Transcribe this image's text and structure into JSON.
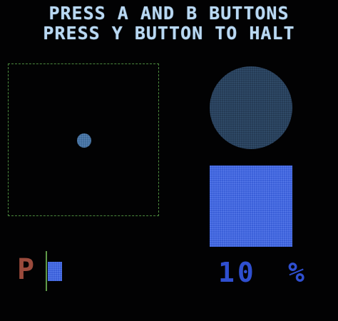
{
  "header": {
    "line1": "PRESS A AND B BUTTONS",
    "line2": "PRESS Y BUTTON TO HALT"
  },
  "gauge": {
    "label": "P",
    "level_fraction": 0.5
  },
  "readout": {
    "value": "10",
    "unit": "%"
  },
  "colors": {
    "title": "#b9d8f2",
    "play_area_border": "#4c8a3e",
    "ball": "#3f6b9a",
    "big_circle": "#253b55",
    "big_square": "#3a5fd8",
    "gauge_label": "#9a4a3c",
    "gauge_line": "#5f9a48",
    "readout": "#2f4fd0"
  }
}
